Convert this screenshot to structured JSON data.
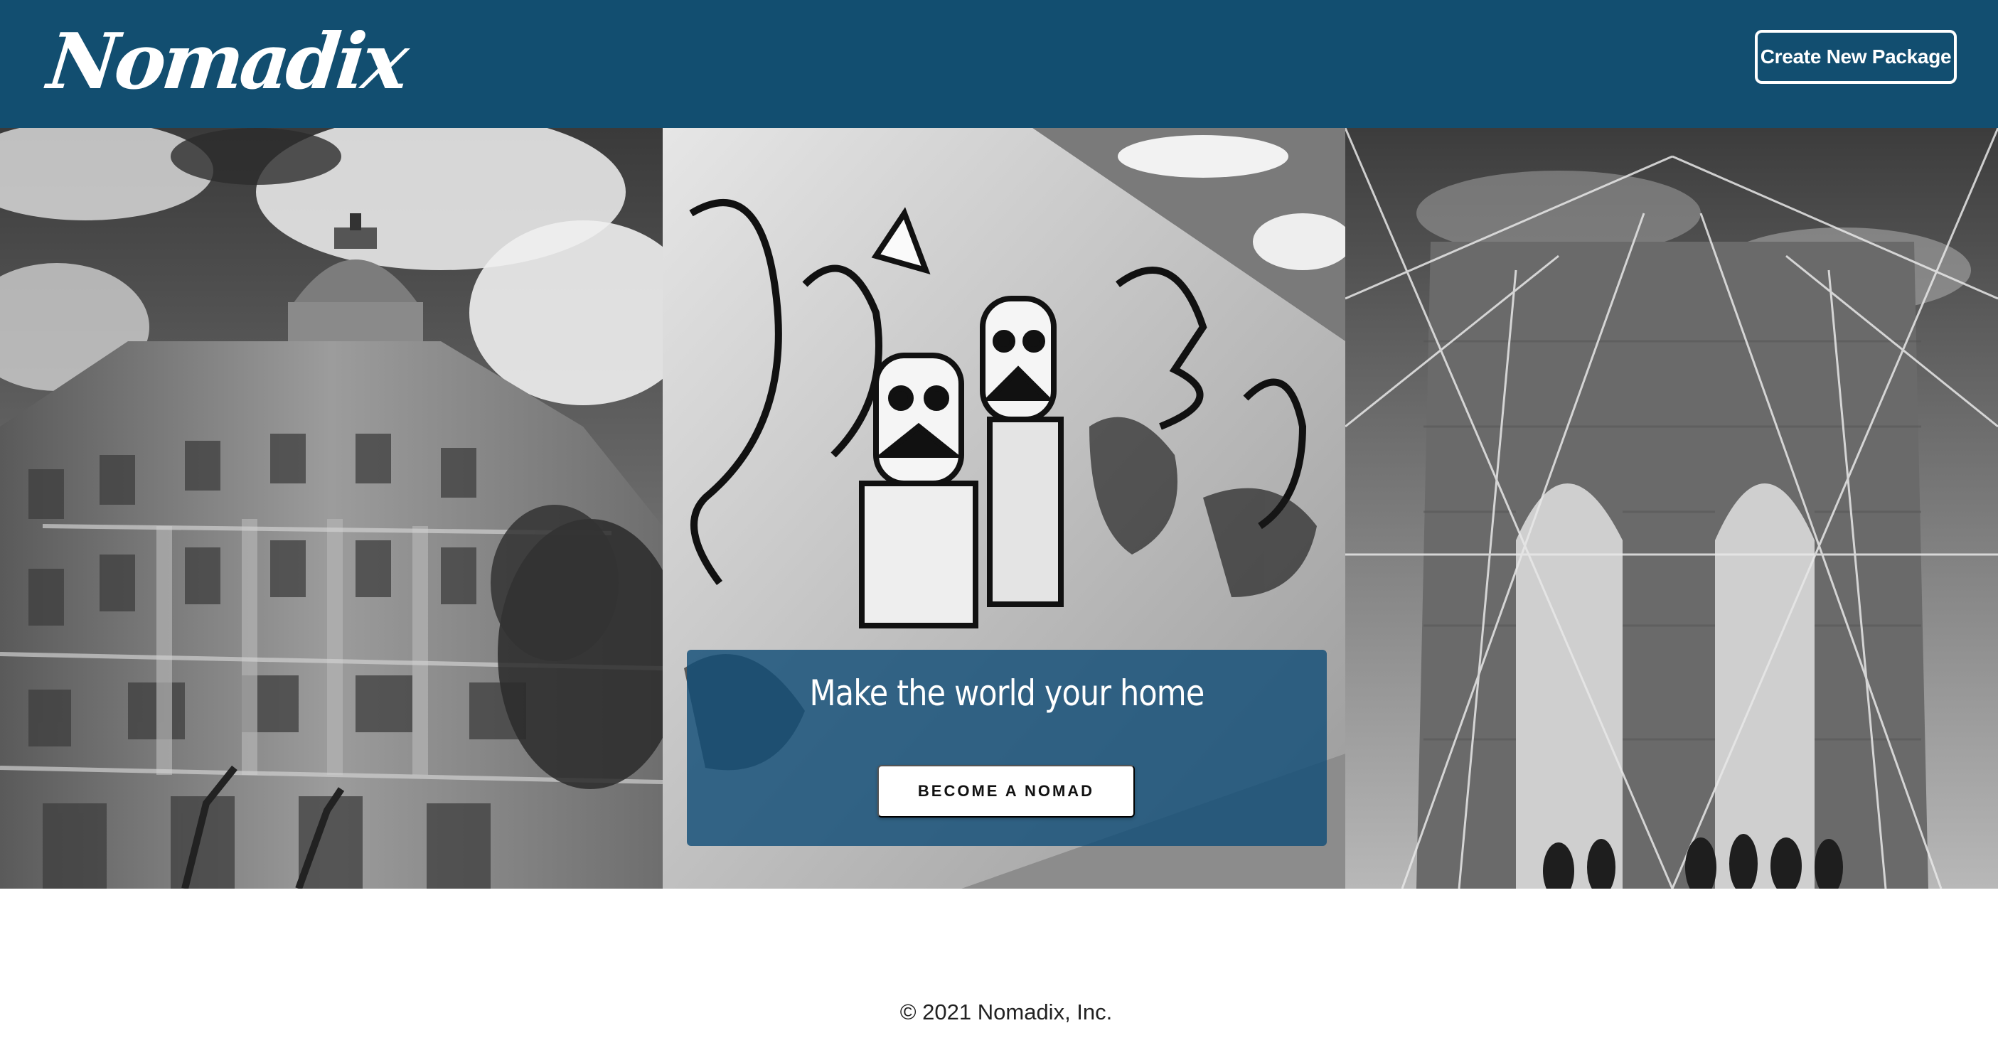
{
  "header": {
    "logo_text": "Nomadix",
    "create_button_label": "Create New Package",
    "background_color": "#124e70"
  },
  "hero": {
    "images": [
      {
        "name": "ornate-domed-building-photo",
        "tone": "grayscale"
      },
      {
        "name": "graffiti-wall-photo",
        "tone": "grayscale"
      },
      {
        "name": "suspension-bridge-photo",
        "tone": "grayscale"
      }
    ],
    "cta": {
      "heading": "Make the world your home",
      "button_label": "BECOME A NOMAD",
      "card_color": "#124e78"
    }
  },
  "footer": {
    "copyright": "© 2021 Nomadix, Inc."
  }
}
